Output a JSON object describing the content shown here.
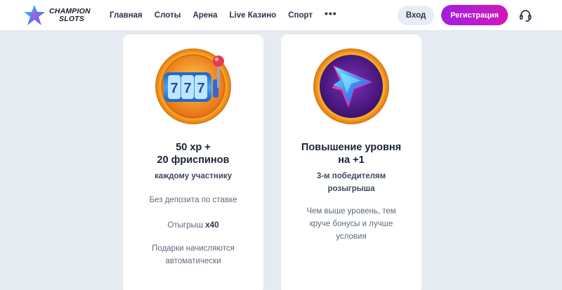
{
  "header": {
    "logo": {
      "line1": "CHAMPION",
      "line2": "SLOTS"
    },
    "nav": [
      "Главная",
      "Слоты",
      "Арена",
      "Live Казино",
      "Спорт"
    ],
    "more": "•••",
    "login_label": "Вход",
    "register_label": "Регистрация",
    "support_icon": "headset-icon"
  },
  "cards": [
    {
      "icon": "slot-machine-icon",
      "title": "50 xp +\n20 фриспинов",
      "subtitle": "каждому участнику",
      "text1": "Без депозита по ставке",
      "text2_prefix": "Отыгрыш ",
      "text2_bold": "x40",
      "text3": "Подарки начисляются\nавтоматически"
    },
    {
      "icon": "level-up-star-icon",
      "title": "Повышение уровня\nна +1",
      "subtitle": "3-м победителям\nрозыгрыша",
      "text1": "Чем выше уровень, тем\nкруче бонусы и лучше\nусловия"
    }
  ],
  "colors": {
    "accent_gradient_start": "#a11fe0",
    "accent_gradient_end": "#d118b8",
    "background": "#e6ebf2"
  }
}
